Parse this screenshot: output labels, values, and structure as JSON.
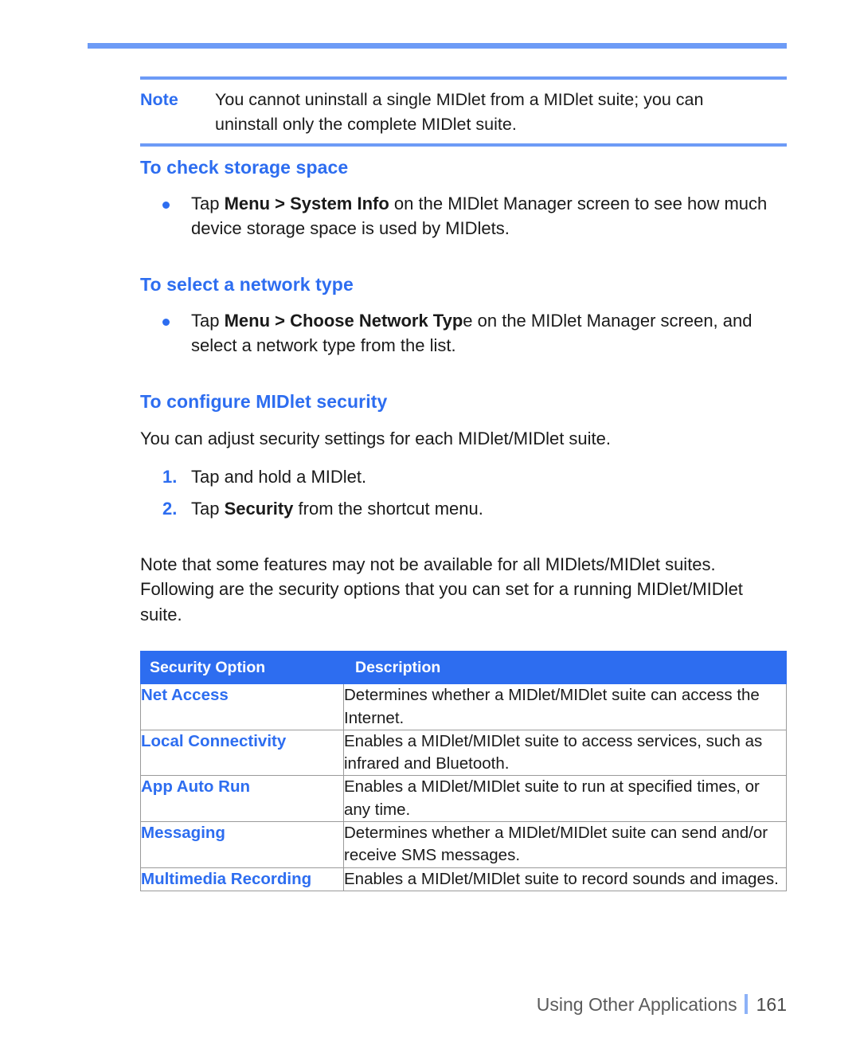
{
  "colors": {
    "accent_blue": "#2d6df0",
    "rule_blue": "#6d9bf6",
    "table_border": "#9a9a9a",
    "body_text": "#1a1a1a",
    "footer_text": "#5b5b5b"
  },
  "note": {
    "label": "Note",
    "line1": "You cannot uninstall a single MIDlet from a MIDlet suite; you can",
    "line2": "uninstall only the complete MIDlet suite."
  },
  "sections": [
    {
      "heading": "To check storage space",
      "bullet": {
        "pre": "Tap ",
        "bold": "Menu > System Info",
        "post": " on the MIDlet Manager screen to see how much device storage space is used by MIDlets."
      }
    },
    {
      "heading": "To select a network type",
      "bullet": {
        "pre": "Tap ",
        "bold": "Menu > Choose Network Typ",
        "post": "e on the MIDlet Manager screen, and select a network type from the list."
      }
    }
  ],
  "security_section": {
    "heading": "To configure MIDlet security",
    "intro": "You can adjust security settings for each MIDlet/MIDlet suite.",
    "steps": [
      {
        "num": "1.",
        "pre": "Tap and hold a MIDlet.",
        "bold": "",
        "post": ""
      },
      {
        "num": "2.",
        "pre": "Tap ",
        "bold": "Security",
        "post": " from the shortcut menu."
      }
    ],
    "note_paragraph": "Note that some features may not be available for all MIDlets/MIDlet suites. Following are the security options that you can set for a running MIDlet/MIDlet suite."
  },
  "table": {
    "headers": [
      "Security Option",
      "Description"
    ],
    "rows": [
      {
        "option": "Net Access",
        "description": "Determines whether a MIDlet/MIDlet suite can access the Internet."
      },
      {
        "option": "Local Connectivity",
        "description": "Enables a MIDlet/MIDlet suite to access services, such as infrared and Bluetooth."
      },
      {
        "option": "App Auto Run",
        "description": "Enables a MIDlet/MIDlet suite to run at specified times, or any time."
      },
      {
        "option": "Messaging",
        "description": "Determines whether a MIDlet/MIDlet suite can send and/or receive SMS messages."
      },
      {
        "option": "Multimedia Recording",
        "description": "Enables a MIDlet/MIDlet suite to record sounds and images."
      }
    ]
  },
  "footer": {
    "chapter": "Using Other Applications",
    "page_number": "161"
  }
}
